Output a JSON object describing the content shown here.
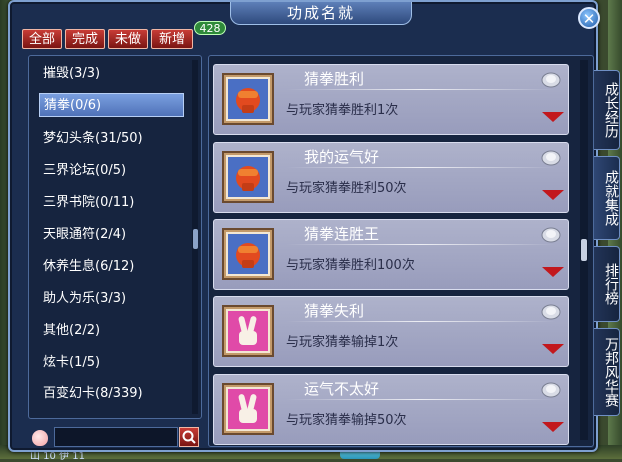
{
  "window": {
    "title": "功成名就",
    "close_label": "✕"
  },
  "filters": [
    {
      "label": "全部"
    },
    {
      "label": "完成"
    },
    {
      "label": "未做"
    },
    {
      "label": "新增"
    }
  ],
  "new_count": "428",
  "categories": [
    {
      "label": "摧毁(3/3)"
    },
    {
      "label": "猜拳(0/6)",
      "selected": true
    },
    {
      "label": "梦幻头条(31/50)"
    },
    {
      "label": "三界论坛(0/5)"
    },
    {
      "label": "三界书院(0/11)"
    },
    {
      "label": "天眼通符(2/4)"
    },
    {
      "label": "休养生息(6/12)"
    },
    {
      "label": "助人为乐(3/3)"
    },
    {
      "label": "其他(2/2)"
    },
    {
      "label": "炫卡(1/5)"
    },
    {
      "label": "百变幻卡(8/339)"
    }
  ],
  "search": {
    "value": ""
  },
  "achievements": [
    {
      "title": "猜拳胜利",
      "desc": "与玩家猜拳胜利1次",
      "icon": "fist-icon"
    },
    {
      "title": "我的运气好",
      "desc": "与玩家猜拳胜利50次",
      "icon": "fist-icon"
    },
    {
      "title": "猜拳连胜王",
      "desc": "与玩家猜拳胜利100次",
      "icon": "fist-icon"
    },
    {
      "title": "猜拳失利",
      "desc": "与玩家猜拳输掉1次",
      "icon": "scissors-hand-icon"
    },
    {
      "title": "运气不太好",
      "desc": "与玩家猜拳输掉50次",
      "icon": "scissors-hand-icon"
    }
  ],
  "side_tabs": [
    {
      "label": "成长经历"
    },
    {
      "label": "成就集成"
    },
    {
      "label": "排行榜"
    },
    {
      "label": "万邦风华赛"
    }
  ],
  "bottom_text": "山 10 伊 11"
}
